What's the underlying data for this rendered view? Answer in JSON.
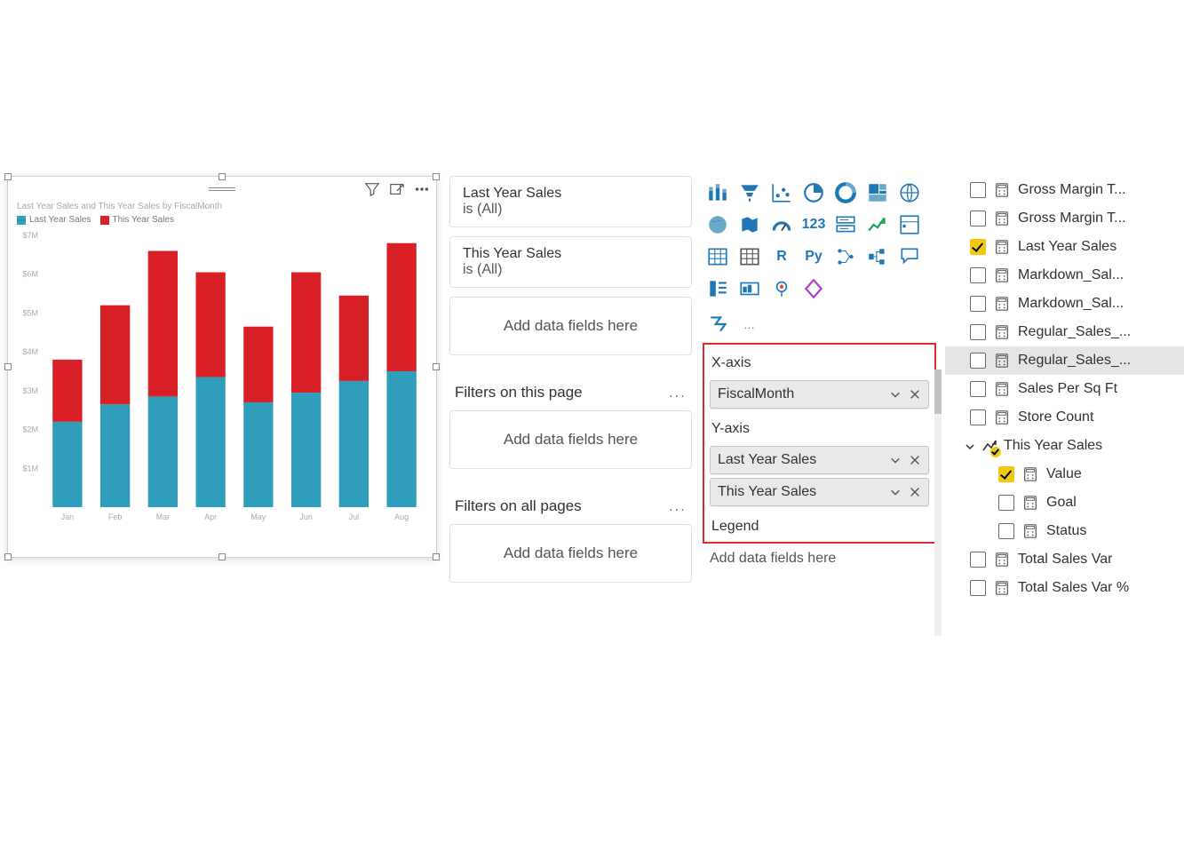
{
  "chart_data": {
    "type": "bar",
    "title": "Last Year Sales and This Year Sales by FiscalMonth",
    "categories": [
      "Jan",
      "Feb",
      "Mar",
      "Apr",
      "May",
      "Jun",
      "Jul",
      "Aug"
    ],
    "series": [
      {
        "name": "Last Year Sales",
        "values": [
          2200000,
          2650000,
          2850000,
          3350000,
          2700000,
          2950000,
          3250000,
          3500000
        ],
        "color": "#2e9eba"
      },
      {
        "name": "This Year Sales",
        "values": [
          1600000,
          2550000,
          3750000,
          2700000,
          1950000,
          3100000,
          2200000,
          3300000
        ],
        "color": "#da2027"
      }
    ],
    "ylabel": "",
    "xlabel": "",
    "y_ticks": [
      "$1M",
      "$2M",
      "$3M",
      "$4M",
      "$5M",
      "$6M",
      "$7M"
    ],
    "ylim": [
      0,
      7000000
    ]
  },
  "visual": {
    "title": "Last Year Sales and This Year Sales by FiscalMonth",
    "legend": [
      "Last Year Sales",
      "This Year Sales"
    ]
  },
  "filters": {
    "visual_filters": [
      {
        "field": "Last Year Sales",
        "summary": "is (All)"
      },
      {
        "field": "This Year Sales",
        "summary": "is (All)"
      }
    ],
    "add_fields_label": "Add data fields here",
    "page_section": "Filters on this page",
    "all_section": "Filters on all pages"
  },
  "wells": {
    "xaxis_label": "X-axis",
    "xaxis_fields": [
      "FiscalMonth"
    ],
    "yaxis_label": "Y-axis",
    "yaxis_fields": [
      "Last Year Sales",
      "This Year Sales"
    ],
    "legend_label": "Legend",
    "add_fields_label": "Add data fields here"
  },
  "fields": {
    "items": [
      {
        "label": "Gross Margin T...",
        "type": "calc",
        "checked": false
      },
      {
        "label": "Gross Margin T...",
        "type": "calc",
        "checked": false
      },
      {
        "label": "Last Year Sales",
        "type": "calc",
        "checked": true
      },
      {
        "label": "Markdown_Sal...",
        "type": "calc",
        "checked": false
      },
      {
        "label": "Markdown_Sal...",
        "type": "calc",
        "checked": false
      },
      {
        "label": "Regular_Sales_...",
        "type": "calc",
        "checked": false
      },
      {
        "label": "Regular_Sales_...",
        "type": "calc",
        "checked": false,
        "selected": true
      },
      {
        "label": "Sales Per Sq Ft",
        "type": "calc",
        "checked": false
      },
      {
        "label": "Store Count",
        "type": "calc",
        "checked": false
      }
    ],
    "hierarchy": {
      "label": "This Year Sales",
      "children": [
        {
          "label": "Value",
          "checked": true
        },
        {
          "label": "Goal",
          "checked": false
        },
        {
          "label": "Status",
          "checked": false
        }
      ]
    },
    "tail": [
      {
        "label": "Total Sales Var",
        "type": "calc",
        "checked": false
      },
      {
        "label": "Total Sales Var %",
        "type": "calc",
        "checked": false
      }
    ]
  }
}
